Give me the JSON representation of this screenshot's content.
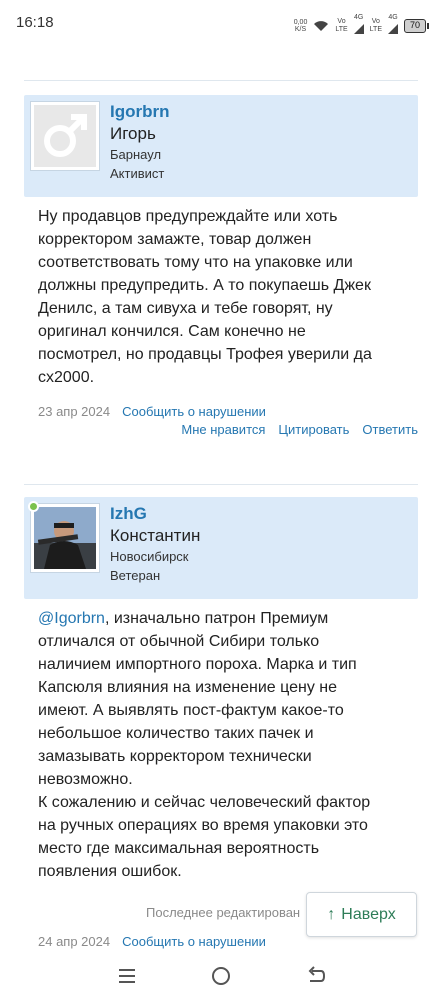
{
  "status_bar": {
    "time": "16:18",
    "net_speed_value": "0,00",
    "net_speed_unit": "K/S",
    "sim1_type": "Vo",
    "sim1_sub": "LTE",
    "sim1_gen": "4G",
    "sim2_type": "Vo",
    "sim2_sub": "LTE",
    "sim2_gen": "4G",
    "battery": "70"
  },
  "posts": [
    {
      "username": "Igorbrn",
      "realname": "Игорь",
      "location": "Барнаул",
      "rank": "Активист",
      "avatar_icon": "male-symbol-icon",
      "body_lines": [
        "Ну продавцов предупреждайте или хоть",
        "корректором замажте, товар должен",
        "соответствовать тому что на упаковке или",
        "должны предупредить. А то покупаешь Джек",
        "Денилс, а там сивуха и тебе говорят, ну",
        "оригинал кончился. Сам конечно не",
        "посмотрел, но продавцы Трофея уверили да",
        "сх2000."
      ],
      "date": "23 апр 2024",
      "report": "Сообщить о нарушении",
      "like": "Мне нравится",
      "quote": "Цитировать",
      "reply": "Ответить"
    },
    {
      "username": "IzhG",
      "realname": "Константин",
      "location": "Новосибирск",
      "rank": "Ветеран",
      "mention": "@Igorbrn",
      "body_first_rest": ", изначально патрон Премиум",
      "body_lines": [
        "отличался от обычной Сибири только",
        "наличием импортного пороха. Марка и тип",
        "Капсюля влияния на изменение цену не",
        "имеют. А выявлять пост-фактум какое-то",
        "небольшое количество таких пачек и",
        "замазывать корректором технически",
        "невозможно.",
        "К сожалению и сейчас человеческий фактор",
        "на ручных операциях во время упаковки это",
        "место где максимальная вероятность",
        "появления ошибок."
      ],
      "edited_note": "Последнее редактирован",
      "date": "24 апр 2024",
      "report": "Сообщить о нарушении"
    }
  ],
  "scroll_top_button": {
    "arrow": "↑",
    "label": "Наверх"
  },
  "nav": {
    "menu_icon": "menu-icon",
    "home_icon": "home-circle-icon",
    "back_icon": "back-icon"
  },
  "colors": {
    "header_bg": "#dbeaf9",
    "link": "#2577b1",
    "top_button_text": "#2e7d58",
    "online": "#7cc24d"
  }
}
